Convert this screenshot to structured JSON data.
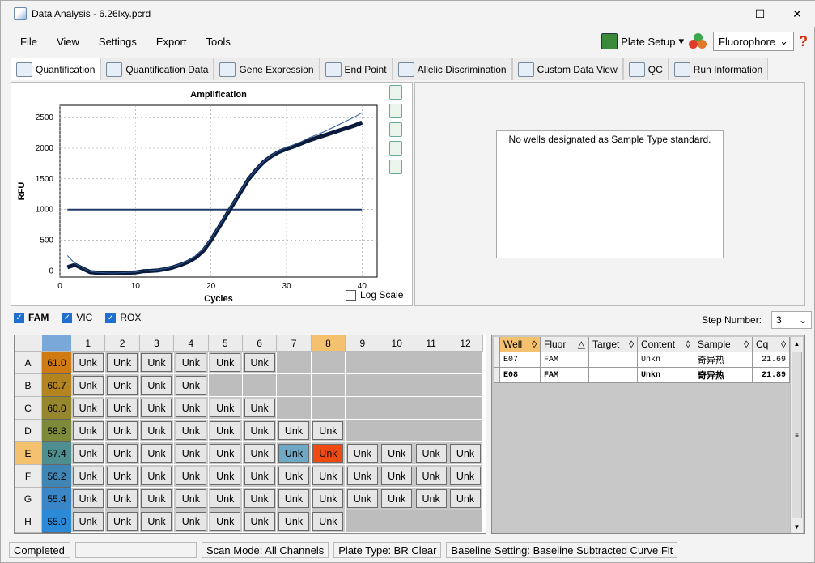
{
  "window": {
    "title": "Data Analysis - 6.26lxy.pcrd",
    "minimize": "—",
    "maximize": "☐",
    "close": "✕"
  },
  "menu": [
    "File",
    "View",
    "Settings",
    "Export",
    "Tools"
  ],
  "toolbar": {
    "plate_setup": "Plate Setup",
    "fluorophore": "Fluorophore",
    "help": "?"
  },
  "tabs": [
    "Quantification",
    "Quantification Data",
    "Gene Expression",
    "End Point",
    "Allelic Discrimination",
    "Custom Data View",
    "QC",
    "Run Information"
  ],
  "chart_data": {
    "type": "line",
    "title": "Amplification",
    "xlabel": "Cycles",
    "ylabel": "RFU",
    "xlim": [
      0,
      42
    ],
    "ylim": [
      -100,
      2700
    ],
    "xticks": [
      0,
      10,
      20,
      30,
      40
    ],
    "yticks": [
      0,
      500,
      1000,
      1500,
      2000,
      2500
    ],
    "threshold": 1000,
    "series": [
      {
        "x": [
          1,
          2,
          3,
          4,
          5,
          6,
          7,
          8,
          9,
          10,
          11,
          12,
          13,
          14,
          15,
          16,
          17,
          18,
          19,
          20,
          21,
          22,
          23,
          24,
          25,
          26,
          27,
          28,
          29,
          30,
          31,
          32,
          33,
          34,
          35,
          36,
          37,
          38,
          39,
          40
        ],
        "values": [
          60,
          100,
          40,
          -20,
          -30,
          -35,
          -40,
          -35,
          -30,
          -25,
          -5,
          0,
          10,
          30,
          60,
          100,
          150,
          220,
          330,
          500,
          700,
          900,
          1100,
          1300,
          1500,
          1650,
          1780,
          1870,
          1940,
          1990,
          2030,
          2080,
          2130,
          2170,
          2210,
          2250,
          2290,
          2330,
          2370,
          2420
        ]
      },
      {
        "x": [
          1,
          2,
          3,
          4,
          5,
          6,
          7,
          8,
          9,
          10,
          11,
          12,
          13,
          14,
          15,
          16,
          17,
          18,
          19,
          20,
          21,
          22,
          23,
          24,
          25,
          26,
          27,
          28,
          29,
          30,
          31,
          32,
          33,
          34,
          35,
          36,
          37,
          38,
          39,
          40
        ],
        "values": [
          250,
          120,
          50,
          -10,
          -25,
          -30,
          -35,
          -30,
          -25,
          -20,
          0,
          10,
          20,
          40,
          70,
          110,
          170,
          250,
          360,
          520,
          720,
          920,
          1120,
          1320,
          1510,
          1660,
          1790,
          1880,
          1960,
          2010,
          2060,
          2110,
          2170,
          2220,
          2270,
          2330,
          2390,
          2450,
          2510,
          2580
        ]
      }
    ]
  },
  "log_scale_label": "Log Scale",
  "std_message": "No wells designated as Sample Type standard.",
  "fluors": [
    {
      "label": "FAM",
      "bold": true
    },
    {
      "label": "VIC",
      "bold": false
    },
    {
      "label": "ROX",
      "bold": false
    }
  ],
  "step": {
    "label": "Step Number:",
    "value": "3"
  },
  "plate": {
    "cols": [
      "1",
      "2",
      "3",
      "4",
      "5",
      "6",
      "7",
      "8",
      "9",
      "10",
      "11",
      "12"
    ],
    "rows": [
      "A",
      "B",
      "C",
      "D",
      "E",
      "F",
      "G",
      "H"
    ],
    "row_cq": [
      "61.0",
      "60.7",
      "60.0",
      "58.8",
      "57.4",
      "56.2",
      "55.4",
      "55.0"
    ],
    "row_cq_colors": [
      "#d07a12",
      "#b48420",
      "#96862c",
      "#7c8a3a",
      "#4f8e8e",
      "#3f86b4",
      "#3a86c6",
      "#2a8ad8"
    ],
    "well_label": "Unk",
    "filled": [
      6,
      4,
      6,
      8,
      12,
      12,
      12,
      8
    ],
    "selected_row": 4,
    "selected_col": 7,
    "highlight_e7": "blue",
    "highlight_e8": "orange"
  },
  "table": {
    "headers": [
      "Well",
      "Fluor",
      "Target",
      "Content",
      "Sample",
      "Cq"
    ],
    "rows": [
      {
        "well": "E07",
        "fluor": "FAM",
        "target": "",
        "content": "Unkn",
        "sample": "奇异热",
        "cq": "21.69",
        "bold": false
      },
      {
        "well": "E08",
        "fluor": "FAM",
        "target": "",
        "content": "Unkn",
        "sample": "奇异热",
        "cq": "21.89",
        "bold": true
      }
    ]
  },
  "status": [
    "Completed",
    "",
    "Scan Mode: All Channels",
    "Plate Type: BR Clear",
    "Baseline Setting: Baseline Subtracted Curve Fit"
  ]
}
